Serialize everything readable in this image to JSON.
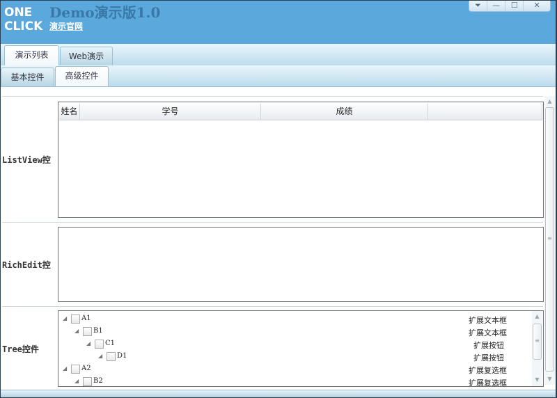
{
  "window": {
    "logo": [
      "ONE",
      "CLICK"
    ],
    "title": "Demo演示版1.0",
    "site_link": "演示官网",
    "controls": [
      {
        "name": "menu",
        "glyph": "⏷"
      },
      {
        "name": "minimize",
        "glyph": "—"
      },
      {
        "name": "maximize",
        "glyph": "☐"
      },
      {
        "name": "close",
        "glyph": "✕"
      }
    ]
  },
  "tabs_top": [
    {
      "label": "演示列表",
      "active": true
    },
    {
      "label": "Web演示",
      "active": false
    }
  ],
  "tabs_sub": [
    {
      "label": "基本控件",
      "active": false
    },
    {
      "label": "高级控件",
      "active": true
    }
  ],
  "listview": {
    "label": "ListView控",
    "columns": [
      "姓名",
      "学号",
      "成绩",
      ""
    ]
  },
  "richedit": {
    "label": "RichEdit控",
    "value": ""
  },
  "tree": {
    "label": "Tree控件",
    "items": [
      {
        "name": "A1",
        "level": 0,
        "ext": "扩展文本框"
      },
      {
        "name": "B1",
        "level": 1,
        "ext": "扩展文本框"
      },
      {
        "name": "C1",
        "level": 2,
        "ext": "扩展按钮"
      },
      {
        "name": "D1",
        "level": 3,
        "ext": "扩展按钮"
      },
      {
        "name": "A2",
        "level": 0,
        "ext": "扩展复选框"
      },
      {
        "name": "B2",
        "level": 1,
        "ext": "扩展复选框"
      }
    ]
  }
}
